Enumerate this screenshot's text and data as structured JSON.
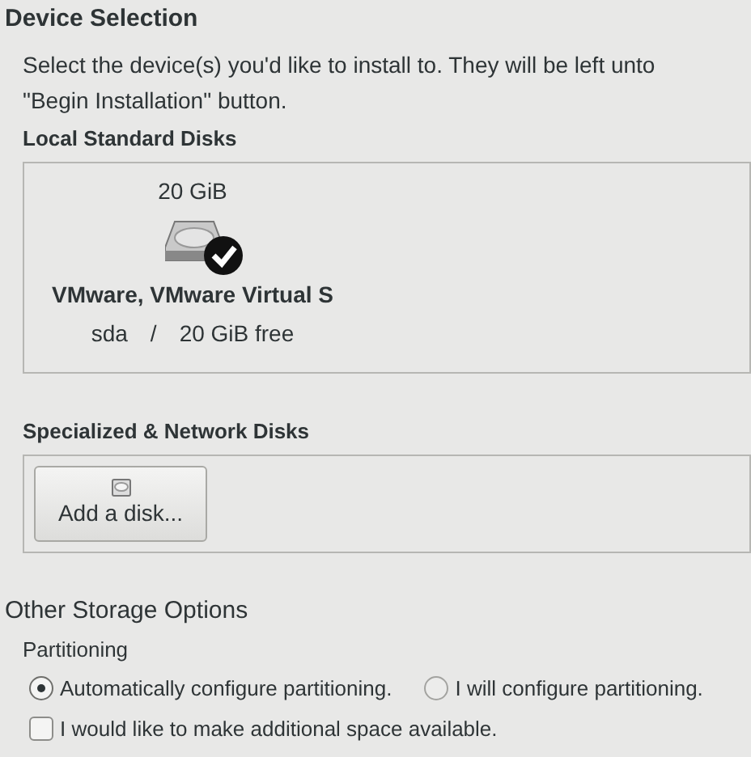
{
  "device_selection": {
    "title": "Device Selection",
    "description_lines": [
      "Select the device(s) you'd like to install to.  They will be left unto",
      "\"Begin Installation\" button."
    ],
    "local_disks": {
      "title": "Local Standard Disks",
      "disks": [
        {
          "size": "20 GiB",
          "name": "VMware, VMware Virtual S",
          "device": "sda",
          "separator": "/",
          "free": "20 GiB free",
          "selected": true
        }
      ]
    },
    "specialized_disks": {
      "title": "Specialized & Network Disks",
      "button": "Add a disk..."
    }
  },
  "other_storage": {
    "title": "Other Storage Options",
    "partitioning": {
      "title": "Partitioning",
      "options": [
        {
          "label": "Automatically configure partitioning.",
          "selected": true
        },
        {
          "label": "I will configure partitioning.",
          "selected": false
        }
      ]
    },
    "additional_space": {
      "label": "I would like to make additional space available.",
      "checked": false
    }
  }
}
